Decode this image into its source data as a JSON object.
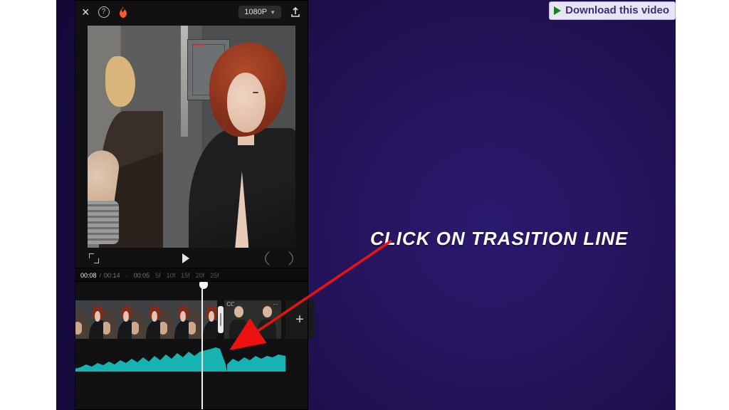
{
  "topbar": {
    "resolution_label": "1080P"
  },
  "transport": {
    "current_time": "00:08",
    "total_time": "00:14"
  },
  "ruler": {
    "marks": [
      "00:05",
      "5f",
      "10f",
      "15f",
      "20f",
      "25f"
    ]
  },
  "clips": {
    "clip2_badge": "CC",
    "add_label": "+"
  },
  "instruction": "CLICK ON TRASITION LINE",
  "download": {
    "label": "Download this video"
  }
}
